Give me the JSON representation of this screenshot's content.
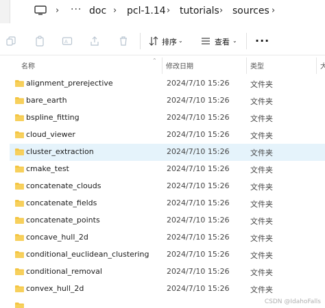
{
  "breadcrumb": {
    "items": [
      "doc",
      "pcl-1.14",
      "tutorials",
      "sources"
    ],
    "more": "···"
  },
  "toolbar": {
    "sort_label": "排序",
    "view_label": "查看",
    "more": "···"
  },
  "columns": {
    "name": "名称",
    "modified": "修改日期",
    "type": "类型",
    "size": "大"
  },
  "files": [
    {
      "name": "alignment_prerejective",
      "date": "2024/7/10 15:26",
      "type": "文件夹"
    },
    {
      "name": "bare_earth",
      "date": "2024/7/10 15:26",
      "type": "文件夹"
    },
    {
      "name": "bspline_fitting",
      "date": "2024/7/10 15:26",
      "type": "文件夹"
    },
    {
      "name": "cloud_viewer",
      "date": "2024/7/10 15:26",
      "type": "文件夹"
    },
    {
      "name": "cluster_extraction",
      "date": "2024/7/10 15:26",
      "type": "文件夹",
      "selected": true
    },
    {
      "name": "cmake_test",
      "date": "2024/7/10 15:26",
      "type": "文件夹"
    },
    {
      "name": "concatenate_clouds",
      "date": "2024/7/10 15:26",
      "type": "文件夹"
    },
    {
      "name": "concatenate_fields",
      "date": "2024/7/10 15:26",
      "type": "文件夹"
    },
    {
      "name": "concatenate_points",
      "date": "2024/7/10 15:26",
      "type": "文件夹"
    },
    {
      "name": "concave_hull_2d",
      "date": "2024/7/10 15:26",
      "type": "文件夹"
    },
    {
      "name": "conditional_euclidean_clustering",
      "date": "2024/7/10 15:26",
      "type": "文件夹"
    },
    {
      "name": "conditional_removal",
      "date": "2024/7/10 15:26",
      "type": "文件夹"
    },
    {
      "name": "convex_hull_2d",
      "date": "2024/7/10 15:26",
      "type": "文件夹"
    }
  ],
  "watermark": "CSDN @IdahoFalls",
  "colors": {
    "folder": "#f4c542",
    "selected_row": "#e5f3fb"
  }
}
